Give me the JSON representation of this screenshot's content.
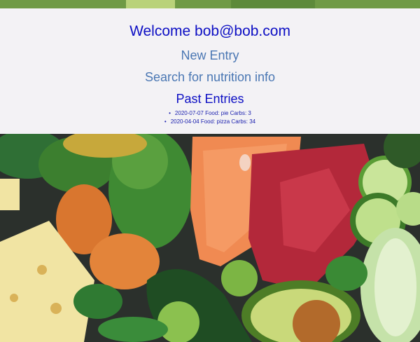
{
  "header": {
    "welcome_text": "Welcome bob@bob.com"
  },
  "nav": {
    "new_entry_label": "New Entry",
    "search_label": "Search for nutrition info"
  },
  "past_entries": {
    "title": "Past Entries",
    "items": [
      "2020-07-07 Food: pie Carbs: 3",
      "2020-04-04 Food: pizza Carbs: 34"
    ]
  },
  "background": {
    "description_icon": "food-background-photo"
  },
  "colors": {
    "panel_bg": "#f3f2f5",
    "heading_blue": "#0d0fc4",
    "link_blue": "#4a77b3",
    "entry_text": "#1a1fae"
  }
}
